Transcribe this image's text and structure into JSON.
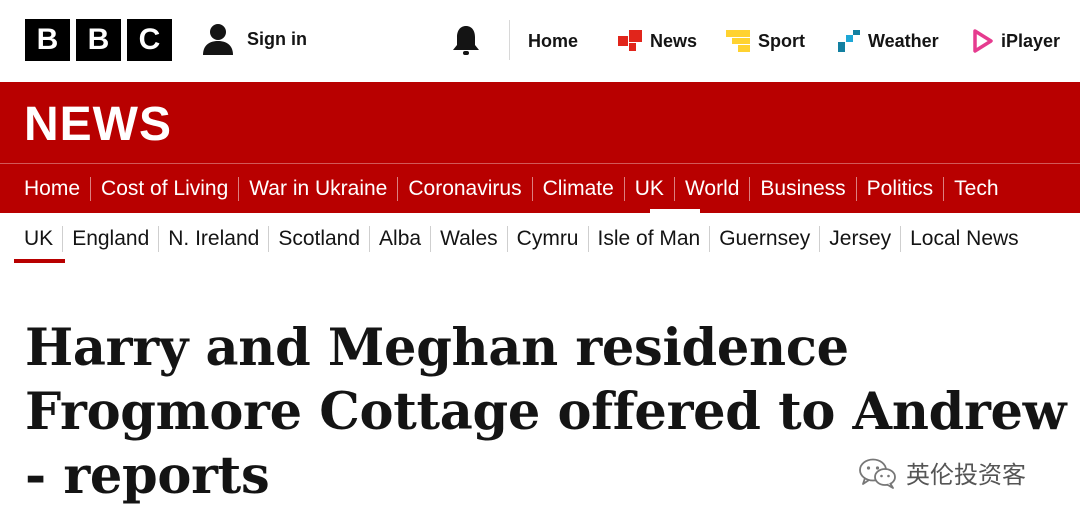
{
  "brand": {
    "logo_letters": [
      "B",
      "B",
      "C"
    ],
    "sign_in_label": "Sign in"
  },
  "top_nav": [
    {
      "label": "Home",
      "icon": "none"
    },
    {
      "label": "News",
      "icon": "news-icon",
      "color": "#e1251b"
    },
    {
      "label": "Sport",
      "icon": "sport-icon",
      "color": "#ffd230"
    },
    {
      "label": "Weather",
      "icon": "weather-icon",
      "color": "#1380a1"
    },
    {
      "label": "iPlayer",
      "icon": "iplayer-icon",
      "color": "#e63b8f"
    }
  ],
  "section": {
    "title": "NEWS",
    "background": "#b80000"
  },
  "primary_nav": {
    "items": [
      "Home",
      "Cost of Living",
      "War in Ukraine",
      "Coronavirus",
      "Climate",
      "UK",
      "World",
      "Business",
      "Politics",
      "Tech"
    ],
    "active": "UK"
  },
  "secondary_nav": {
    "items": [
      "UK",
      "England",
      "N. Ireland",
      "Scotland",
      "Alba",
      "Wales",
      "Cymru",
      "Isle of Man",
      "Guernsey",
      "Jersey",
      "Local News"
    ],
    "active": "UK"
  },
  "article": {
    "headline": "Harry and Meghan residence Frogmore Cottage offered to Andrew - reports"
  },
  "watermark": {
    "text": "英伦投资客",
    "icon": "wechat-icon"
  }
}
